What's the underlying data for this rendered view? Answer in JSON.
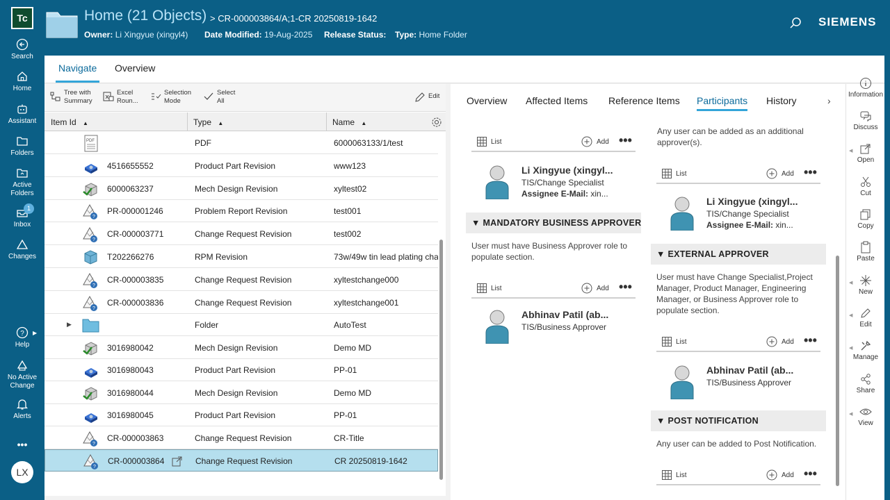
{
  "app": {
    "logo": "Tc",
    "brand": "SIEMENS",
    "user_initials": "LX"
  },
  "leftnav": [
    {
      "label": "Search",
      "icon": "back-arrow-icon"
    },
    {
      "label": "Home",
      "icon": "home-icon"
    },
    {
      "label": "Assistant",
      "icon": "assistant-icon"
    },
    {
      "label": "Folders",
      "icon": "folder-icon"
    },
    {
      "label": "Active Folders",
      "icon": "active-folder-icon"
    },
    {
      "label": "Inbox",
      "icon": "inbox-icon",
      "badge": "1"
    },
    {
      "label": "Changes",
      "icon": "changes-icon"
    },
    {
      "label": "Help",
      "icon": "help-icon"
    },
    {
      "label": "No Active Change",
      "icon": "change-icon"
    },
    {
      "label": "Alerts",
      "icon": "bell-icon"
    },
    {
      "label": "•••",
      "icon": "more-icon"
    }
  ],
  "header": {
    "title": "Home (21 Objects)",
    "crumb": "> CR-000003864/A;1-CR 20250819-1642",
    "owner_label": "Owner:",
    "owner_value": "Li Xingyue (xingyl4)",
    "modified_label": "Date Modified:",
    "modified_value": "19-Aug-2025",
    "release_label": "Release Status:",
    "release_value": "",
    "type_label": "Type:",
    "type_value": "Home Folder"
  },
  "top_tabs": [
    "Navigate",
    "Overview"
  ],
  "toolbar": {
    "tree_line1": "Tree with",
    "tree_line2": "Summary",
    "excel_line1": "Excel",
    "excel_line2": "Roun...",
    "sel_line1": "Selection",
    "sel_line2": "Mode",
    "selall_line1": "Select",
    "selall_line2": "All",
    "edit": "Edit"
  },
  "columns": [
    "Item Id",
    "Type",
    "Name"
  ],
  "rows": [
    {
      "id": "",
      "type": "PDF",
      "name": "6000063133/1/test",
      "icon": "pdf"
    },
    {
      "id": "4516655552",
      "type": "Product Part Revision",
      "name": "www123",
      "icon": "part"
    },
    {
      "id": "6000063237",
      "type": "Mech Design Revision",
      "name": "xyltest02",
      "icon": "mech"
    },
    {
      "id": "PR-000001246",
      "type": "Problem Report Revision",
      "name": "test001",
      "icon": "change"
    },
    {
      "id": "CR-000003771",
      "type": "Change Request Revision",
      "name": "test002",
      "icon": "change"
    },
    {
      "id": "T202266276",
      "type": "RPM Revision",
      "name": "73w/49w tin lead plating cha",
      "icon": "rpm"
    },
    {
      "id": "CR-000003835",
      "type": "Change Request Revision",
      "name": "xyltestchange000",
      "icon": "change"
    },
    {
      "id": "CR-000003836",
      "type": "Change Request Revision",
      "name": "xyltestchange001",
      "icon": "change"
    },
    {
      "id": "",
      "type": "Folder",
      "name": "AutoTest",
      "icon": "folder"
    },
    {
      "id": "3016980042",
      "type": "Mech Design Revision",
      "name": "Demo MD",
      "icon": "mech"
    },
    {
      "id": "3016980043",
      "type": "Product Part Revision",
      "name": "PP-01",
      "icon": "part"
    },
    {
      "id": "3016980044",
      "type": "Mech Design Revision",
      "name": "Demo MD",
      "icon": "mech"
    },
    {
      "id": "3016980045",
      "type": "Product Part Revision",
      "name": "PP-01",
      "icon": "part"
    },
    {
      "id": "CR-000003863",
      "type": "Change Request Revision",
      "name": "CR-Title",
      "icon": "change"
    },
    {
      "id": "CR-000003864",
      "type": "Change Request Revision",
      "name": "CR 20250819-1642",
      "icon": "change"
    }
  ],
  "right_tabs": [
    "Overview",
    "Affected Items",
    "Reference Items",
    "Participants",
    "History"
  ],
  "participants": {
    "list_label": "List",
    "add_label": "Add",
    "dots": "•••",
    "left_person1": {
      "name": "Li Xingyue (xingyl...",
      "role": "TIS/Change Specialist",
      "mail_label": "Assignee E-Mail:",
      "mail_value": "xin..."
    },
    "mandatory_header": "▼ MANDATORY BUSINESS APPROVER",
    "mandatory_note": "User must have Business Approver role to populate section.",
    "left_person2": {
      "name": "Abhinav Patil (ab...",
      "role": "TIS/Business Approver"
    },
    "additional_note": "Any user can be added as an additional approver(s).",
    "right_person1": {
      "name": "Li Xingyue (xingyl...",
      "role": "TIS/Change Specialist",
      "mail_label": "Assignee E-Mail:",
      "mail_value": "xin..."
    },
    "external_header": "▼ EXTERNAL APPROVER",
    "external_note": "User must have Change Specialist,Project Manager, Product Manager, Engineering Manager, or Business Approver role to populate section.",
    "right_person2": {
      "name": "Abhinav Patil (ab...",
      "role": "TIS/Business Approver"
    },
    "post_header": "▼ POST NOTIFICATION",
    "post_note": "Any user can be added to Post Notification."
  },
  "actions": [
    "Information",
    "Discuss",
    "Open",
    "Cut",
    "Copy",
    "Paste",
    "New",
    "Edit",
    "Manage",
    "Share",
    "View"
  ],
  "colors": {
    "brand": "#0b5f86",
    "accent": "#33a5d9",
    "selected_row": "#b5dfee"
  }
}
